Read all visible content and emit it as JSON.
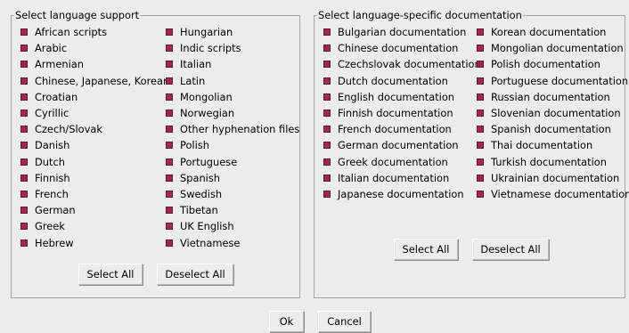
{
  "language_support": {
    "title": "Select language support",
    "left_items": [
      "African scripts",
      "Arabic",
      "Armenian",
      "Chinese, Japanese, Korean",
      "Croatian",
      "Cyrillic",
      "Czech/Slovak",
      "Danish",
      "Dutch",
      "Finnish",
      "French",
      "German",
      "Greek",
      "Hebrew"
    ],
    "right_items": [
      "Hungarian",
      "Indic scripts",
      "Italian",
      "Latin",
      "Mongolian",
      "Norwegian",
      "Other hyphenation files",
      "Polish",
      "Portuguese",
      "Spanish",
      "Swedish",
      "Tibetan",
      "UK English",
      "Vietnamese"
    ],
    "select_all_label": "Select All",
    "deselect_all_label": "Deselect All"
  },
  "documentation": {
    "title": "Select language-specific documentation",
    "left_items": [
      "Bulgarian documentation",
      "Chinese documentation",
      "Czechslovak documentation",
      "Dutch documentation",
      "English documentation",
      "Finnish documentation",
      "French documentation",
      "German documentation",
      "Greek documentation",
      "Italian documentation",
      "Japanese documentation"
    ],
    "right_items": [
      "Korean documentation",
      "Mongolian documentation",
      "Polish documentation",
      "Portuguese documentation",
      "Russian documentation",
      "Slovenian documentation",
      "Spanish documentation",
      "Thai documentation",
      "Turkish documentation",
      "Ukrainian documentation",
      "Vietnamese documentation"
    ],
    "select_all_label": "Select All",
    "deselect_all_label": "Deselect All"
  },
  "dialog": {
    "ok_label": "Ok",
    "cancel_label": "Cancel"
  },
  "colors": {
    "checkbox_selected": "#a0284e",
    "background": "#ececec"
  }
}
